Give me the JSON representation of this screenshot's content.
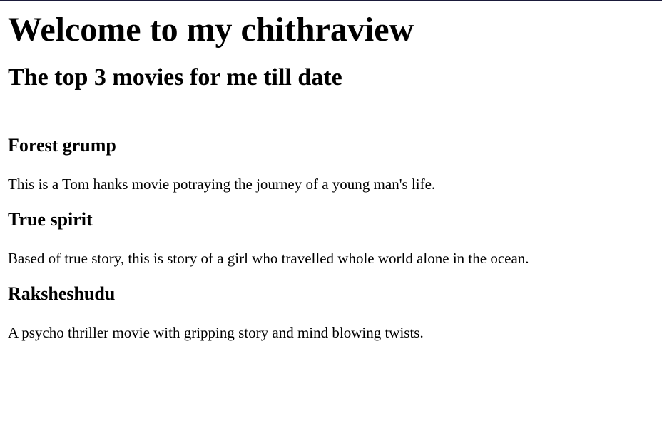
{
  "page": {
    "heading": "Welcome to my chithraview",
    "subheading": "The top 3 movies for me till date"
  },
  "movies": [
    {
      "title": "Forest grump",
      "description": "This is a Tom hanks movie potraying the journey of a young man's life."
    },
    {
      "title": "True spirit",
      "description": "Based of true story, this is story of a girl who travelled whole world alone in the ocean."
    },
    {
      "title": "Raksheshudu",
      "description": "A psycho thriller movie with gripping story and mind blowing twists."
    }
  ]
}
